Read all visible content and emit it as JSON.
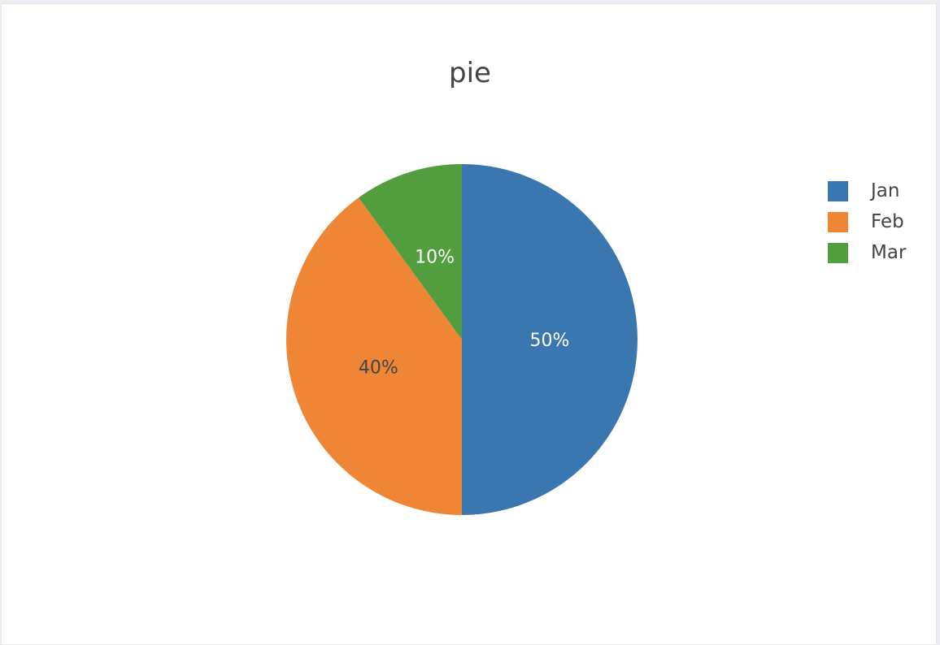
{
  "chart_data": {
    "type": "pie",
    "title": "pie",
    "labels": [
      "Jan",
      "Feb",
      "Mar"
    ],
    "values": [
      50,
      40,
      10
    ],
    "percent_labels": [
      "50%",
      "40%",
      "10%"
    ],
    "colors": [
      "#3a76af",
      "#ef8636",
      "#529d3e"
    ],
    "text_colors": [
      "#ffffff",
      "#444444",
      "#ffffff"
    ],
    "direction": "clockwise",
    "legend_position": "top-right"
  }
}
